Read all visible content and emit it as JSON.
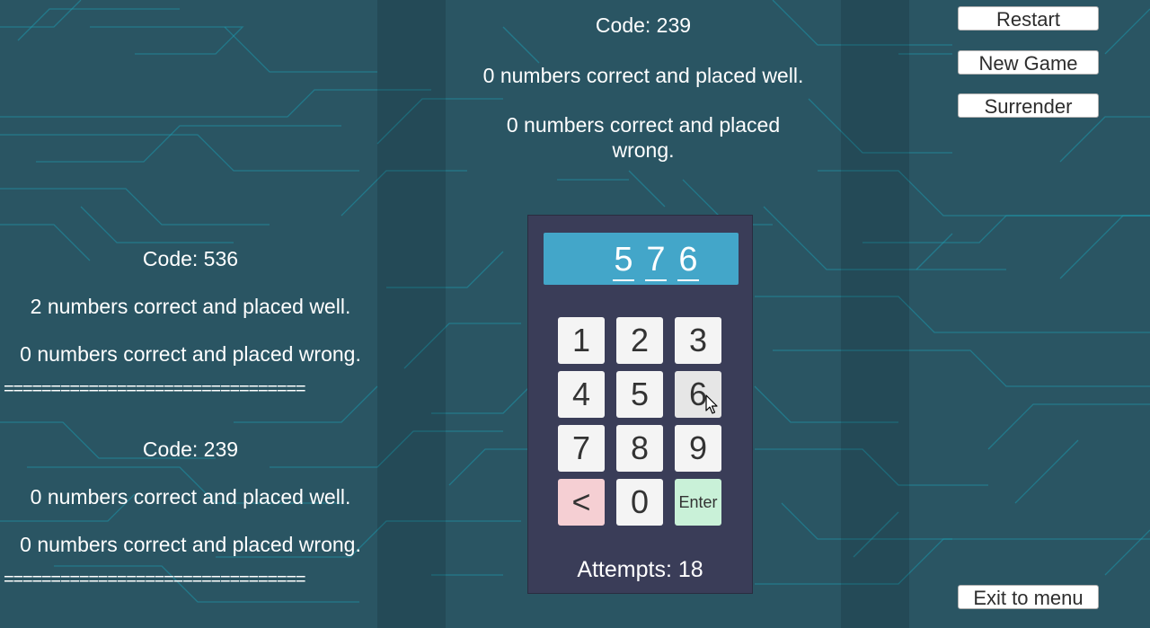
{
  "current_feedback": {
    "code": "Code: 239",
    "correct_well": "0 numbers correct and placed well.",
    "correct_wrong": "0 numbers correct and placed wrong."
  },
  "history": [
    {
      "code": "Code: 536",
      "correct_well": "2 numbers correct and placed well.",
      "correct_wrong": "0 numbers correct and placed wrong.",
      "separator": "================================"
    },
    {
      "code": "Code: 239",
      "correct_well": "0 numbers correct and placed well.",
      "correct_wrong": "0 numbers correct and placed wrong.",
      "separator": "================================"
    }
  ],
  "keypad": {
    "display_digits": [
      "5",
      "7",
      "6"
    ],
    "keys": [
      "1",
      "2",
      "3",
      "4",
      "5",
      "6",
      "7",
      "8",
      "9",
      "<",
      "0",
      "Enter"
    ],
    "attempts": "Attempts: 18"
  },
  "buttons": {
    "restart": "Restart",
    "new_game": "New Game",
    "surrender": "Surrender",
    "exit": "Exit to menu"
  },
  "colors": {
    "background": "#2a5563",
    "circuit_lines": "#1aa7bd",
    "keypad_panel": "#3a3d58",
    "display": "#43a6c9",
    "backspace_key": "#f5cfd3",
    "enter_key": "#c9f1d8"
  },
  "icons": {
    "cursor": "mouse-pointer-icon"
  }
}
